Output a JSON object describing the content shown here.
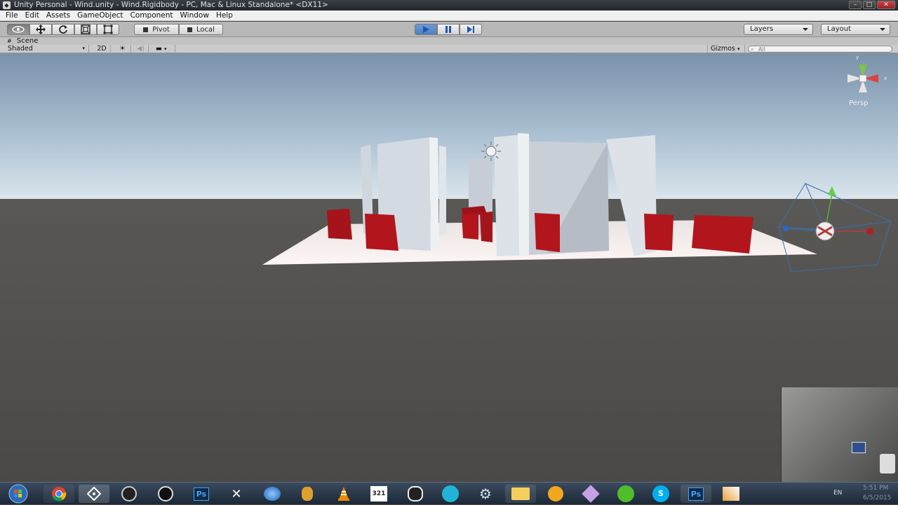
{
  "window": {
    "title": "Unity Personal - Wind.unity - Wind.Rigidbody - PC, Mac & Linux Standalone* <DX11>",
    "buttons": [
      "–",
      "□",
      "✕"
    ]
  },
  "menu": [
    "File",
    "Edit",
    "Assets",
    "GameObject",
    "Component",
    "Window",
    "Help"
  ],
  "toolbar": {
    "transform_tools": [
      "hand-tool",
      "move-tool",
      "rotate-tool",
      "scale-tool",
      "rect-tool"
    ],
    "pivot_label": "Pivot",
    "local_label": "Local",
    "layers_label": "Layers",
    "layout_label": "Layout"
  },
  "scene": {
    "tab_label": "Scene",
    "shading_mode": "Shaded",
    "mode_2d": "2D",
    "gizmos_label": "Gizmos",
    "search_placeholder": "All",
    "view_label": "Persp"
  },
  "taskbar": {
    "apps": [
      "start",
      "chrome",
      "unity",
      "app-g1",
      "app-g2",
      "Ps",
      "zbrush",
      "network",
      "pineapple",
      "vlc",
      "calendar",
      "game",
      "skype-blue",
      "settings",
      "folder",
      "headphones",
      "diamond",
      "utorrent",
      "skype",
      "Ps",
      "paint"
    ],
    "language": "EN",
    "time": "5:51 PM",
    "date": "6/5/2015"
  },
  "colors": {
    "red_boxes": "#b3151c",
    "walls": "#d7dde4",
    "sky_top": "#7f95ad",
    "sky_horizon": "#d7e2ea",
    "ground": "#504e4b"
  }
}
